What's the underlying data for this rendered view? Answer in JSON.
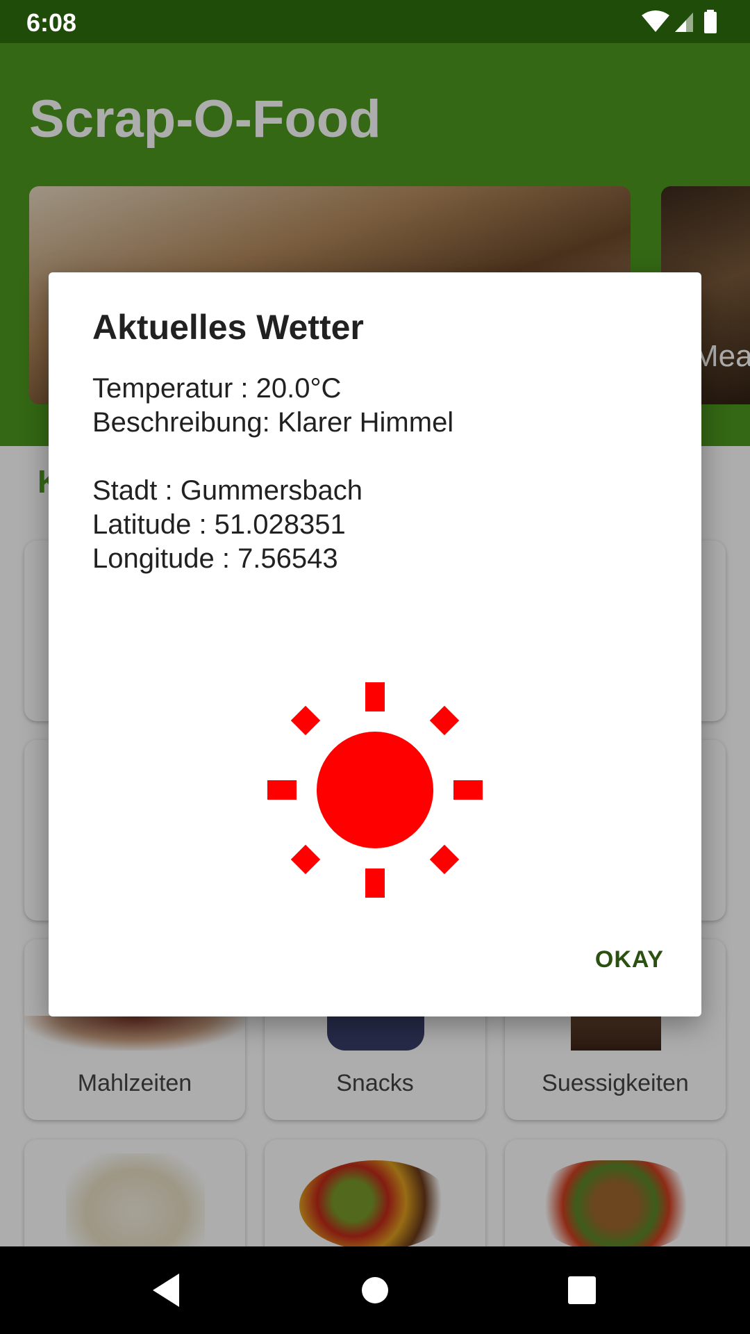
{
  "status_bar": {
    "time": "6:08"
  },
  "app": {
    "title": "Scrap-O-Food",
    "banners": [
      {
        "label": ""
      },
      {
        "label": "Mea"
      }
    ],
    "section_title": "K",
    "categories": [
      {
        "label": "Mahlzeiten"
      },
      {
        "label": "Snacks"
      },
      {
        "label": "Suessigkeiten"
      }
    ]
  },
  "dialog": {
    "title": "Aktuelles Wetter",
    "lines": {
      "temperature": "Temperatur : 20.0°C",
      "description": "Beschreibung: Klarer Himmel",
      "city": "Stadt : Gummersbach",
      "latitude": "Latitude : 51.028351",
      "longitude": "Longitude : 7.56543"
    },
    "weather_icon": "sun-icon",
    "icon_color": "#ff0000",
    "button_label": "OKAY"
  },
  "colors": {
    "status_bar": "#1f4c08",
    "header_green": "#4d9a1e",
    "button_text": "#2b5110"
  }
}
